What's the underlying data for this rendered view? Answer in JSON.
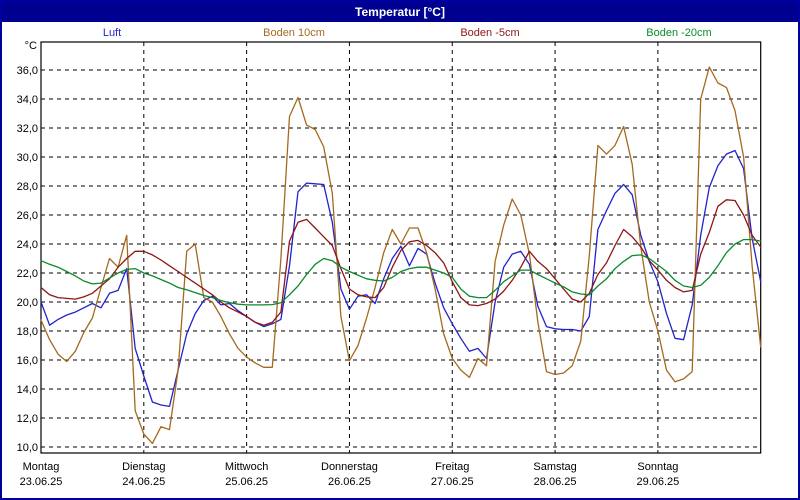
{
  "window": {
    "title": "Temperatur [°C]"
  },
  "legend": [
    {
      "label": "Luft",
      "color": "#2222cc"
    },
    {
      "label": "Boden 10cm",
      "color": "#a5691e"
    },
    {
      "label": "Boden -5cm",
      "color": "#8e1616"
    },
    {
      "label": "Boden -20cm",
      "color": "#0a8a2a"
    }
  ],
  "chart_data": {
    "type": "line",
    "title": "Temperatur [°C]",
    "ylabel": "°C",
    "y_unit_label": "°C",
    "ylim": [
      9.6,
      37.9
    ],
    "grid": true,
    "y_ticks": [
      36,
      34,
      32,
      30,
      28,
      26,
      24,
      22,
      20,
      18,
      16,
      14,
      12,
      10
    ],
    "y_tick_labels": [
      "36,0",
      "34,0",
      "32,0",
      "30,0",
      "28,0",
      "26,0",
      "24,0",
      "22,0",
      "20,0",
      "18,0",
      "16,0",
      "14,0",
      "12,0",
      "10,0"
    ],
    "x_ticks": [
      {
        "day": "Montag",
        "date": "23.06.25"
      },
      {
        "day": "Dienstag",
        "date": "24.06.25"
      },
      {
        "day": "Mittwoch",
        "date": "25.06.25"
      },
      {
        "day": "Donnerstag",
        "date": "26.06.25"
      },
      {
        "day": "Freitag",
        "date": "27.06.25"
      },
      {
        "day": "Samstag",
        "date": "28.06.25"
      },
      {
        "day": "Sonntag",
        "date": "29.06.25"
      }
    ],
    "x_start_hour": 0,
    "x_step_hours": 2,
    "x_total_hours": 168,
    "series": [
      {
        "name": "Luft",
        "color": "#2222cc",
        "values": [
          20.0,
          18.4,
          18.8,
          19.1,
          19.3,
          19.6,
          19.9,
          19.6,
          20.6,
          20.8,
          22.3,
          16.8,
          14.9,
          13.1,
          12.9,
          12.8,
          15.3,
          17.8,
          19.2,
          20.1,
          20.4,
          19.8,
          19.9,
          19.4,
          19.0,
          18.6,
          18.3,
          18.5,
          18.8,
          22.5,
          27.6,
          28.2,
          28.15,
          28.1,
          25.5,
          20.9,
          19.5,
          20.4,
          20.5,
          19.9,
          21.6,
          23.0,
          23.85,
          22.5,
          23.7,
          23.3,
          21.3,
          19.6,
          18.5,
          17.5,
          16.6,
          16.8,
          16.1,
          20.0,
          22.4,
          23.3,
          23.5,
          22.6,
          19.7,
          18.3,
          18.15,
          18.1,
          18.1,
          18.0,
          19.0,
          25.0,
          26.3,
          27.5,
          28.1,
          27.4,
          24.6,
          22.8,
          21.4,
          19.2,
          17.5,
          17.4,
          19.8,
          24.6,
          27.9,
          29.4,
          30.2,
          30.45,
          29.2,
          24.4,
          21.4
        ]
      },
      {
        "name": "Boden 10cm",
        "color": "#a5691e",
        "values": [
          18.75,
          17.4,
          16.4,
          15.9,
          16.6,
          17.9,
          18.9,
          21.0,
          23.0,
          22.4,
          24.6,
          12.5,
          10.9,
          10.25,
          11.4,
          11.2,
          15.3,
          23.5,
          24.0,
          20.3,
          20.0,
          19.0,
          17.8,
          16.8,
          16.2,
          15.8,
          15.5,
          15.5,
          23.0,
          32.8,
          34.1,
          32.2,
          31.9,
          30.7,
          27.5,
          19.0,
          15.95,
          17.0,
          18.9,
          21.0,
          23.4,
          25.0,
          24.0,
          25.1,
          25.1,
          23.4,
          20.9,
          17.8,
          16.1,
          15.3,
          14.8,
          16.1,
          15.6,
          22.8,
          25.3,
          27.1,
          26.0,
          23.3,
          18.6,
          15.2,
          15.0,
          15.1,
          15.6,
          17.3,
          23.2,
          30.8,
          30.2,
          30.8,
          32.1,
          29.5,
          23.8,
          20.0,
          18.0,
          15.3,
          14.5,
          14.7,
          15.2,
          34.0,
          36.2,
          35.1,
          34.8,
          33.2,
          30.0,
          22.5,
          16.9
        ]
      },
      {
        "name": "Boden -5cm",
        "color": "#8e1616",
        "values": [
          21.0,
          20.5,
          20.3,
          20.25,
          20.2,
          20.35,
          20.6,
          21.1,
          21.6,
          22.4,
          23.0,
          23.5,
          23.5,
          23.25,
          22.9,
          22.5,
          22.1,
          21.7,
          21.3,
          20.9,
          20.5,
          20.0,
          19.6,
          19.3,
          19.0,
          18.6,
          18.4,
          18.6,
          19.3,
          24.2,
          25.5,
          25.7,
          25.1,
          24.5,
          23.9,
          22.3,
          20.9,
          20.5,
          20.35,
          20.3,
          21.0,
          22.4,
          23.55,
          24.15,
          24.25,
          23.9,
          23.4,
          22.7,
          21.4,
          20.3,
          19.8,
          19.75,
          19.9,
          20.2,
          20.75,
          21.5,
          22.4,
          23.5,
          22.8,
          22.3,
          21.6,
          20.9,
          20.2,
          20.0,
          20.6,
          21.9,
          22.7,
          23.9,
          25.0,
          24.5,
          23.8,
          22.85,
          22.2,
          21.5,
          21.0,
          20.7,
          20.8,
          23.3,
          24.8,
          26.6,
          27.05,
          27.0,
          26.0,
          24.6,
          23.8
        ]
      },
      {
        "name": "Boden -20cm",
        "color": "#0a8a2a",
        "values": [
          22.85,
          22.6,
          22.4,
          22.1,
          21.8,
          21.45,
          21.25,
          21.3,
          21.65,
          22.0,
          22.25,
          22.3,
          22.0,
          21.8,
          21.55,
          21.3,
          21.0,
          20.85,
          20.65,
          20.45,
          20.3,
          20.1,
          19.95,
          19.85,
          19.8,
          19.8,
          19.8,
          19.82,
          19.95,
          20.5,
          21.1,
          21.9,
          22.6,
          23.0,
          22.85,
          22.4,
          22.1,
          21.85,
          21.6,
          21.5,
          21.45,
          21.7,
          22.1,
          22.3,
          22.4,
          22.4,
          22.2,
          22.0,
          21.7,
          20.9,
          20.4,
          20.3,
          20.3,
          20.8,
          21.4,
          21.8,
          22.2,
          22.2,
          21.9,
          21.6,
          21.3,
          21.05,
          20.7,
          20.55,
          20.5,
          21.1,
          21.6,
          22.3,
          22.8,
          23.2,
          23.25,
          23.0,
          22.55,
          22.1,
          21.5,
          21.1,
          21.0,
          21.15,
          21.7,
          22.5,
          23.4,
          24.0,
          24.3,
          24.3,
          24.2
        ]
      }
    ]
  }
}
